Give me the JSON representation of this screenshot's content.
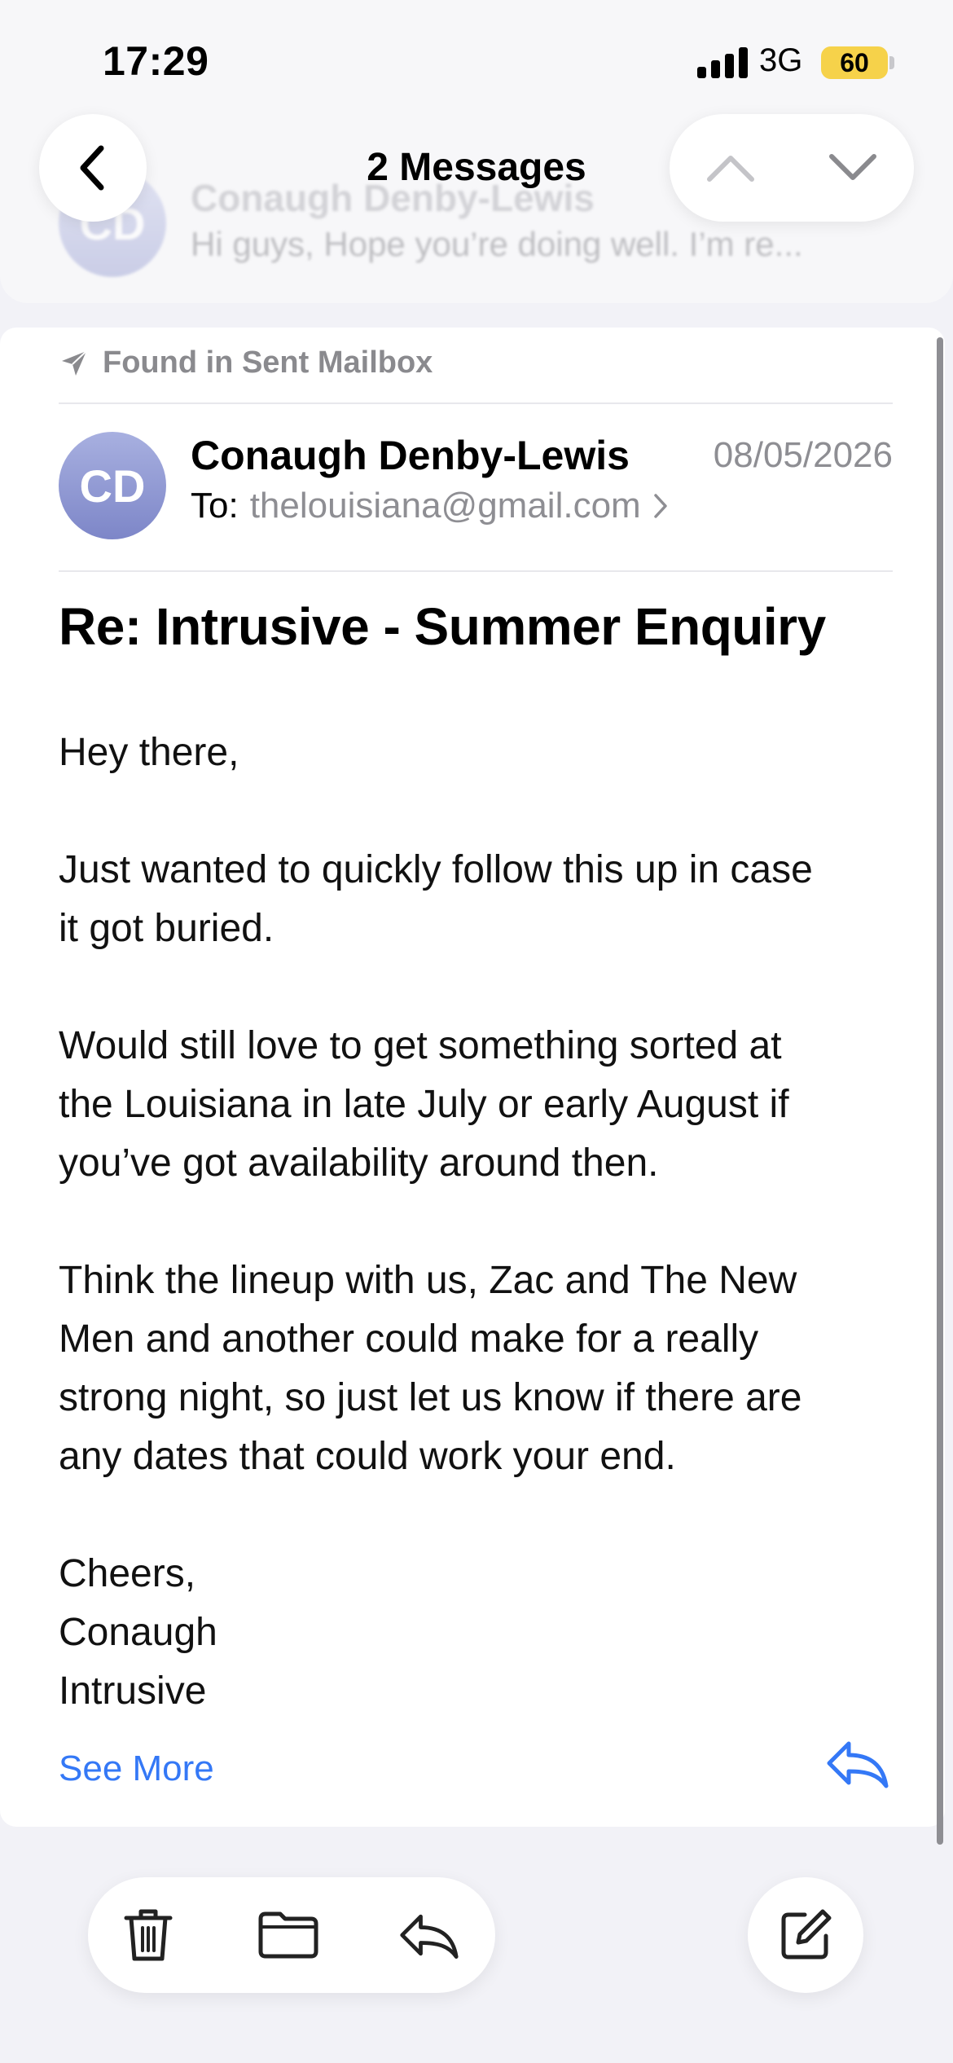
{
  "status_bar": {
    "time": "17:29",
    "network": "3G",
    "battery": "60"
  },
  "nav": {
    "title": "2 Messages"
  },
  "previous_message": {
    "initials": "CD",
    "sender": "Conaugh Denby-Lewis",
    "snippet": "Hi guys, Hope you’re doing well. I’m re..."
  },
  "message": {
    "found_in": "Found in Sent Mailbox",
    "initials": "CD",
    "sender": "Conaugh Denby-Lewis",
    "date": "08/05/2026",
    "to_label": "To:",
    "to_address": "thelouisiana@gmail.com",
    "subject": "Re: Intrusive - Summer Enquiry",
    "body": {
      "greeting": "Hey there,",
      "p1_line1": "Just wanted to quickly follow this up in case",
      "p1_line2": "it got buried.",
      "p2_line1": "Would still love to get something sorted at",
      "p2_line2": "the Louisiana in late July or early August if",
      "p2_line3": "you’ve got availability around then.",
      "p3_line1": "Think the lineup with us, Zac and The New",
      "p3_line2": "Men and another could make for a really",
      "p3_line3": "strong night, so just let us know if there are",
      "p3_line4": "any dates that could work your end.",
      "sign1": "Cheers,",
      "sign2": "Conaugh",
      "sign3": "Intrusive"
    },
    "see_more": "See More"
  },
  "colors": {
    "accent": "#3478f6",
    "avatar": "#7d86c8",
    "battery": "#f6d24a"
  },
  "icons": [
    "back-chevron-icon",
    "chevron-up-icon",
    "chevron-down-icon",
    "paper-plane-icon",
    "chevron-right-icon",
    "reply-icon",
    "trash-icon",
    "folder-icon",
    "compose-icon"
  ]
}
